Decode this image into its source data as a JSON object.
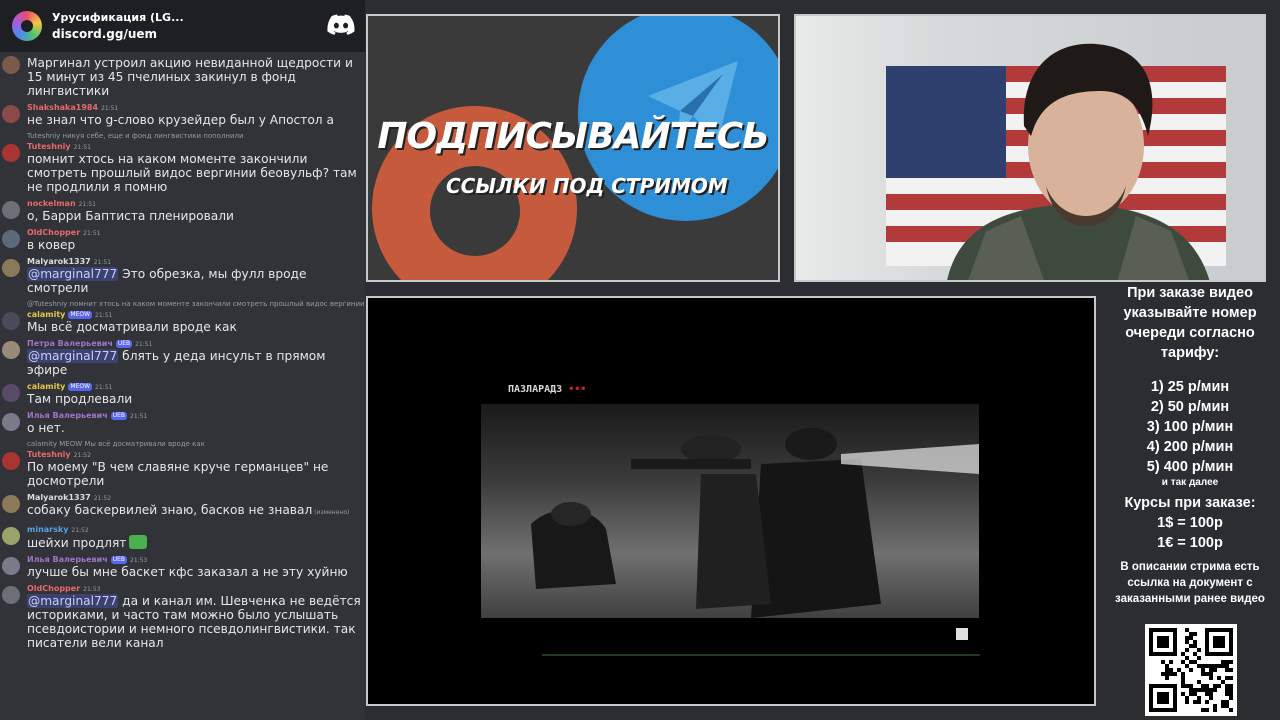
{
  "discord": {
    "server_name": "Урусификация (LG...",
    "invite": "discord.gg/uem",
    "logo_icon": "discord-icon"
  },
  "messages": [
    {
      "reply": "",
      "user": "",
      "user_color": "#e6e7e9",
      "badge": "",
      "time": "",
      "text": "Маргинал устроил акцию невиданной щедрости и 15 минут из 45 пчелиных закинул в фонд лингвистики"
    },
    {
      "reply": "",
      "user": "Shakshaka1984",
      "user_color": "#e86a6a",
      "badge": "",
      "time": "21:51",
      "text": "не знал что g-слово крузейдер был у Апостол а"
    },
    {
      "reply": "Tuteshniy никуя себе, еще и фонд лингвистики пополнили",
      "user": "Tuteshniy",
      "user_color": "#e86a6a",
      "badge": "",
      "time": "21:51",
      "text": "помнит хтось на каком моменте закончили смотреть прошлый видос вергинии беовульф? там не продлили я помню"
    },
    {
      "reply": "",
      "user": "nockelman",
      "user_color": "#e86a6a",
      "badge": "",
      "time": "21:51",
      "text": "о, Барри Баптиста пленировали"
    },
    {
      "reply": "",
      "user": "OldChopper",
      "user_color": "#e86a6a",
      "badge": "",
      "time": "21:51",
      "text": "в ковер"
    },
    {
      "reply": "",
      "user": "Malyarok1337",
      "user_color": "#dcddde",
      "badge": "",
      "time": "21:51",
      "mention": "@marginal777",
      "text": "Это обрезка, мы фулл вроде смотрели"
    },
    {
      "reply": "@Tuteshniy помнит хтось на каком моменте закончили смотреть прошлый видос вергинии беовул",
      "user": "calamity",
      "user_color": "#e8c74a",
      "badge": "MEOW",
      "time": "21:51",
      "text": "Мы всё досматривали вроде как"
    },
    {
      "reply": "",
      "user": "Петра Валерьевич",
      "user_color": "#a074c4",
      "badge": "UEB",
      "time": "21:51",
      "mention": "@marginal777",
      "text": "блять у деда инсульт в прямом эфире"
    },
    {
      "reply": "",
      "user": "calamity",
      "user_color": "#e8c74a",
      "badge": "MEOW",
      "time": "21:51",
      "text": "Там продлевали"
    },
    {
      "reply": "",
      "user": "Илья Валерьевич",
      "user_color": "#a074c4",
      "badge": "UEB",
      "time": "21:51",
      "text": "о нет."
    },
    {
      "reply": "calamity MEOW Мы всё досматривали вроде как",
      "user": "Tuteshniy",
      "user_color": "#e86a6a",
      "badge": "",
      "time": "21:52",
      "text": "По моему \"В чем славяне круче германцев\" не досмотрели"
    },
    {
      "reply": "",
      "user": "Malyarok1337",
      "user_color": "#dcddde",
      "badge": "",
      "time": "21:52",
      "text": "собаку баскервилей знаю, басков не знавал",
      "edited": "(изменено)"
    },
    {
      "reply": "",
      "user": "minarsky",
      "user_color": "#5aa0e8",
      "badge": "",
      "time": "21:52",
      "text": "шейхи продлят",
      "has_emoji": true
    },
    {
      "reply": "",
      "user": "Илья Валерьевич",
      "user_color": "#a074c4",
      "badge": "UEB",
      "time": "21:53",
      "text": "лучше бы мне баскет кфс заказал а не эту хуйню"
    },
    {
      "reply": "",
      "user": "OldChopper",
      "user_color": "#e86a6a",
      "badge": "",
      "time": "21:53",
      "mention": "@marginal777",
      "text": "да и канал им. Шевченка не ведётся историками, и часто там можно было услышать псевдоистории и немного псевдолингвистики. так писатели вели канал"
    }
  ],
  "promo": {
    "title": "ПОДПИСЫВАЙТЕСЬ",
    "subtitle": "ССЫЛКИ ПОД СТРИМОМ",
    "icons": [
      "patreon-icon",
      "telegram-icon"
    ]
  },
  "video": {
    "channel_logo": "ПАЗЛАРАДЗ"
  },
  "info": {
    "heading": "При заказе видео указывайте номер очереди согласно тарифу:",
    "tiers": [
      "1) 25 р/мин",
      "2) 50 р/мин",
      "3) 100 р/мин",
      "4) 200 р/мин",
      "5) 400 р/мин"
    ],
    "etc": "и так далее",
    "rates_heading": "Курсы при заказе:",
    "rates": [
      "1$ = 100р",
      "1€ = 100р"
    ],
    "description": "В описании стрима есть ссылка на документ с заказанными ранее видео"
  },
  "colors": {
    "chat_bg": "#313338",
    "discord_bar": "#1e1f22",
    "mention_bg": "#3c4270",
    "patreon": "#c65a3c",
    "telegram": "#2f8fd6"
  }
}
